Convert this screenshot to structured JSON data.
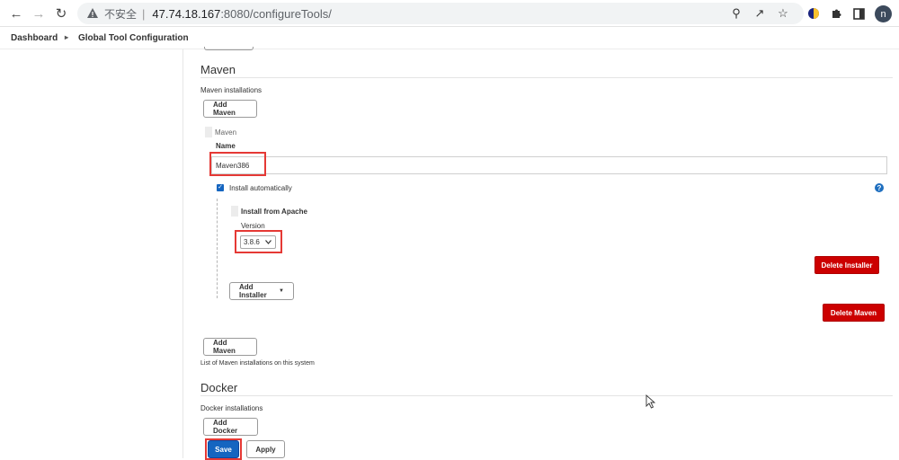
{
  "browser": {
    "insecure_label": "不安全",
    "url_host": "47.74.18.167",
    "url_path": ":8080/configureTools/",
    "avatar_initial": "n"
  },
  "breadcrumb": {
    "items": [
      "Dashboard",
      "Global Tool Configuration"
    ]
  },
  "maven": {
    "section_title": "Maven",
    "installations_label": "Maven installations",
    "add_button_top": "Add Maven",
    "item_header": "Maven",
    "name_label": "Name",
    "name_value": "Maven386",
    "install_auto_label": "Install automatically",
    "installer_title": "Install from Apache",
    "version_label": "Version",
    "version_value": "3.8.6",
    "delete_installer": "Delete Installer",
    "add_installer": "Add Installer",
    "delete_maven": "Delete Maven",
    "add_button_bottom": "Add Maven",
    "list_note": "List of Maven installations on this system"
  },
  "docker": {
    "section_title": "Docker",
    "installations_label": "Docker installations",
    "add_button": "Add Docker"
  },
  "footer": {
    "save": "Save",
    "apply": "Apply"
  },
  "colors": {
    "highlight": "#e53935",
    "danger": "#cc0000",
    "primary": "#1565c0"
  }
}
